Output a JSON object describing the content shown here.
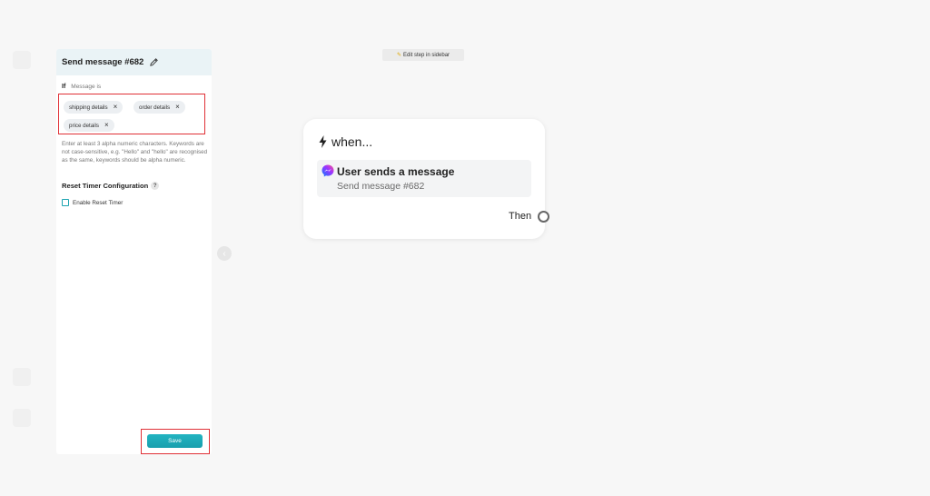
{
  "sidebar": {
    "title": "Send message #682",
    "if_label": "If",
    "condition_label": "Message is",
    "keywords": [
      "shipping details",
      "order details",
      "price details"
    ],
    "remove_glyph": "×",
    "helper_text": "Enter at least 3 alpha numeric characters. Keywords are not case-sensitive, e.g. \"Hello\" and \"hello\" are recognised as the same, keywords should be alpha numeric.",
    "reset_timer_title": "Reset Timer Configuration",
    "help_glyph": "?",
    "enable_reset_timer_label": "Enable Reset Timer",
    "enable_reset_timer_checked": false,
    "save_label": "Save"
  },
  "canvas": {
    "edit_hint": "Edit step in sidebar",
    "collapse_glyph": "‹"
  },
  "node": {
    "when_label": "when...",
    "trigger_title": "User sends a message",
    "trigger_subtitle": "Send message #682",
    "then_label": "Then"
  },
  "icons": [
    "edit-pencil-icon",
    "bolt-icon",
    "messenger-icon",
    "help-icon",
    "chevron-left-icon"
  ],
  "colors": {
    "accent": "#1aa3b0",
    "highlight_border": "#e03036",
    "sidebar_header": "#eaf3f6",
    "messenger_gradient_start": "#0a7cff",
    "messenger_gradient_end": "#ff5c87"
  }
}
